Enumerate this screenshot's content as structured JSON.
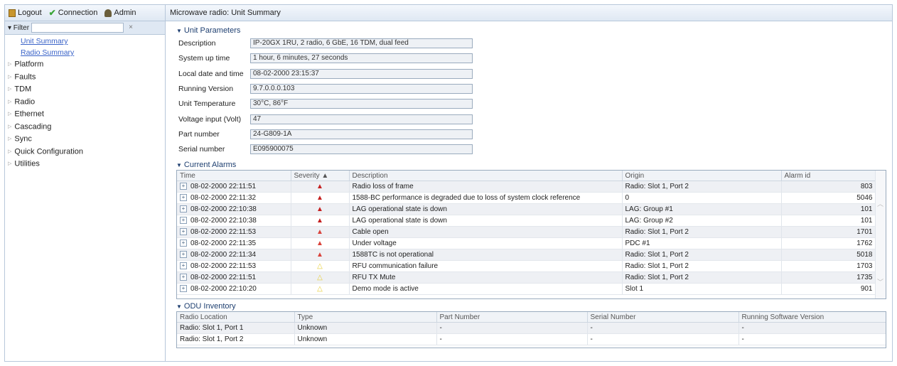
{
  "topbar": {
    "logout": "Logout",
    "connection": "Connection",
    "admin": "Admin"
  },
  "filter": {
    "label": "▾ Filter",
    "value": "",
    "clear": "×"
  },
  "nav_links": [
    "Unit Summary",
    "Radio Summary"
  ],
  "nav_items": [
    "Platform",
    "Faults",
    "TDM",
    "Radio",
    "Ethernet",
    "Cascading",
    "Sync",
    "Quick Configuration",
    "Utilities"
  ],
  "title": "Microwave radio: Unit Summary",
  "unit_params": {
    "header": "Unit Parameters",
    "rows": [
      {
        "label": "Description",
        "value": "IP-20GX 1RU, 2 radio, 6 GbE, 16 TDM, dual feed"
      },
      {
        "label": "System up time",
        "value": "1 hour, 6 minutes, 27 seconds"
      },
      {
        "label": "Local date and time",
        "value": "08-02-2000 23:15:37"
      },
      {
        "label": "Running Version",
        "value": "9.7.0.0.0.103"
      },
      {
        "label": "Unit Temperature",
        "value": "30°C, 86°F"
      },
      {
        "label": "Voltage input (Volt)",
        "value": "47"
      },
      {
        "label": "Part number",
        "value": "24-G809-1A"
      },
      {
        "label": "Serial number",
        "value": "E095900075"
      }
    ]
  },
  "alarms": {
    "header": "Current Alarms",
    "columns": [
      "Time",
      "Severity ▲",
      "Description",
      "Origin",
      "Alarm id"
    ],
    "rows": [
      {
        "time": "08-02-2000 22:11:51",
        "severity": "critical",
        "description": "Radio loss of frame",
        "origin": "Radio: Slot 1, Port 2",
        "id": "803"
      },
      {
        "time": "08-02-2000 22:11:32",
        "severity": "critical",
        "description": "1588-BC performance is degraded due to loss of system clock reference",
        "origin": "0",
        "id": "5046"
      },
      {
        "time": "08-02-2000 22:10:38",
        "severity": "critical",
        "description": "LAG operational state is down",
        "origin": "LAG: Group #1",
        "id": "101"
      },
      {
        "time": "08-02-2000 22:10:38",
        "severity": "critical",
        "description": "LAG operational state is down",
        "origin": "LAG: Group #2",
        "id": "101"
      },
      {
        "time": "08-02-2000 22:11:53",
        "severity": "major",
        "description": "Cable open",
        "origin": "Radio: Slot 1, Port 2",
        "id": "1701"
      },
      {
        "time": "08-02-2000 22:11:35",
        "severity": "major",
        "description": "Under voltage",
        "origin": "PDC #1",
        "id": "1762"
      },
      {
        "time": "08-02-2000 22:11:34",
        "severity": "major",
        "description": "1588TC is not operational",
        "origin": "Radio: Slot 1, Port 2",
        "id": "5018"
      },
      {
        "time": "08-02-2000 22:11:53",
        "severity": "minor",
        "description": "RFU communication failure",
        "origin": "Radio: Slot 1, Port 2",
        "id": "1703"
      },
      {
        "time": "08-02-2000 22:11:51",
        "severity": "minor",
        "description": "RFU TX Mute",
        "origin": "Radio: Slot 1, Port 2",
        "id": "1735"
      },
      {
        "time": "08-02-2000 22:10:20",
        "severity": "minor",
        "description": "Demo mode is active",
        "origin": "Slot 1",
        "id": "901"
      }
    ]
  },
  "severity_colors": {
    "critical": "#c41f1f",
    "major": "#d9423a",
    "minor": "#e8cf3a"
  },
  "odu": {
    "header": "ODU Inventory",
    "columns": [
      "Radio Location",
      "Type",
      "Part Number",
      "Serial Number",
      "Running Software Version"
    ],
    "rows": [
      {
        "location": "Radio: Slot 1, Port 1",
        "type": "Unknown",
        "part": "-",
        "serial": "-",
        "software": "-"
      },
      {
        "location": "Radio: Slot 1, Port 2",
        "type": "Unknown",
        "part": "-",
        "serial": "-",
        "software": "-"
      }
    ]
  }
}
